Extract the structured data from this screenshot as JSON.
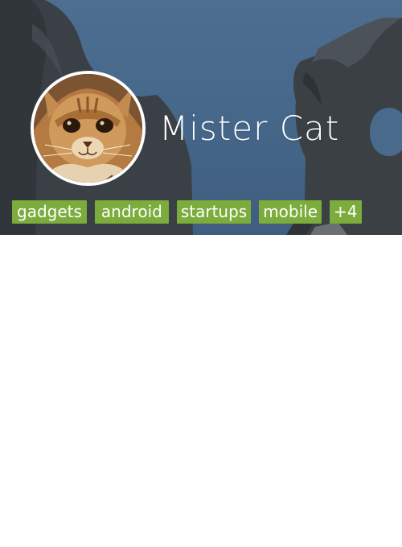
{
  "profile": {
    "name": "Mister Cat",
    "avatar_icon": "cat-photo"
  },
  "tags": [
    {
      "label": "gadgets"
    },
    {
      "label": "android"
    },
    {
      "label": "startups"
    },
    {
      "label": "mobile"
    },
    {
      "label": "+4"
    }
  ],
  "colors": {
    "header_sky": "#4d6e90",
    "tag_background": "#7cac3c",
    "tag_text": "#ffffff",
    "name_text": "#ffffff",
    "page_background": "#ffffff"
  }
}
